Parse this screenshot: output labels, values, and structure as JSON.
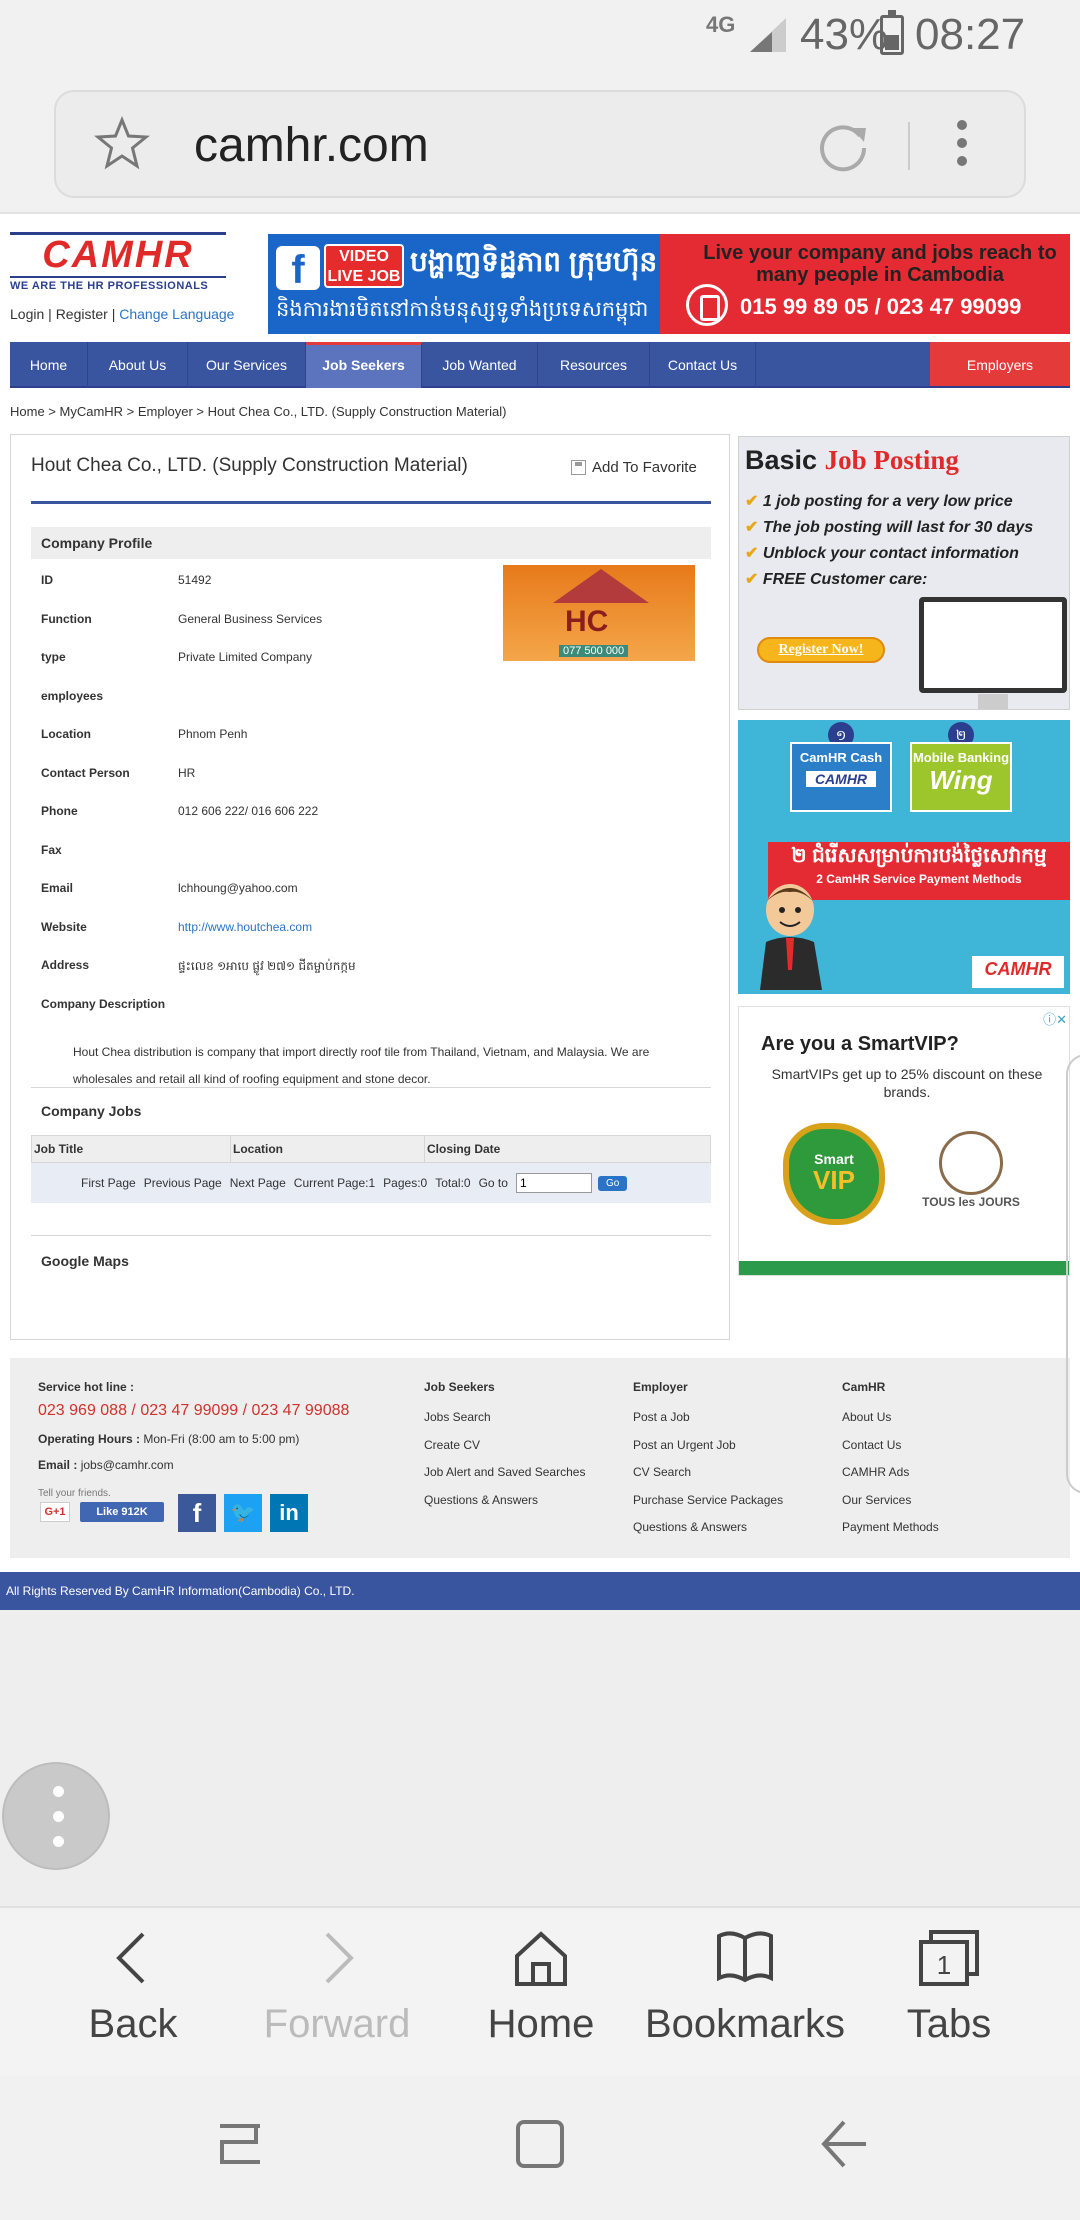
{
  "status_bar": {
    "network": "4G",
    "battery": "43%",
    "time": "08:27"
  },
  "address_bar": {
    "url": "camhr.com"
  },
  "site": {
    "logo": {
      "brand": "CAMHR",
      "tagline": "WE ARE THE HR PROFESSIONALS"
    },
    "login": "Login",
    "register": "Register",
    "change_language": "Change Language",
    "banner": {
      "fb_letter": "f",
      "video_label": "VIDEO",
      "live_label": "LIVE JOB",
      "kh_line1": "បង្ហាញទិដ្ឋភាព ក្រុមហ៊ុន",
      "kh_line2": "និងការងារមិតនៅកាន់មនុស្សទូទាំងប្រទេសកម្ពុជា",
      "reach": "Live your company and jobs reach to many people in Cambodia",
      "phones": "015 99 89 05 / 023 47 99099"
    },
    "nav": [
      "Home",
      "About Us",
      "Our Services",
      "Job Seekers",
      "Job Wanted",
      "Resources",
      "Contact Us"
    ],
    "nav_employers": "Employers",
    "breadcrumb": "Home > MyCamHR > Employer > Hout Chea Co., LTD. (Supply Construction Material)"
  },
  "company": {
    "title": "Hout Chea Co., LTD. (Supply Construction Material)",
    "add_favorite": "Add To Favorite",
    "profile_heading": "Company Profile",
    "logo_text": "HC",
    "logo_phone": "077 500 000",
    "fields": [
      {
        "label": "ID",
        "value": "51492"
      },
      {
        "label": "Function",
        "value": "General Business Services"
      },
      {
        "label": "type",
        "value": "Private Limited Company"
      },
      {
        "label": "employees",
        "value": ""
      },
      {
        "label": "Location",
        "value": "Phnom Penh"
      },
      {
        "label": "Contact Person",
        "value": "HR"
      },
      {
        "label": "Phone",
        "value": "012 606 222/ 016 606 222"
      },
      {
        "label": "Fax",
        "value": ""
      },
      {
        "label": "Email",
        "value": "lchhoung@yahoo.com"
      },
      {
        "label": "Website",
        "value": "http://www.houtchea.com"
      },
      {
        "label": "Address",
        "value": "ផ្ទះលេខ ១អាបេ ផ្លូវ ២៧១ ជីតម្ចាប់កក្កម"
      },
      {
        "label": "Company Description",
        "value": ""
      }
    ],
    "description": "Hout Chea distribution is company that import directly roof tile from Thailand, Vietnam, and Malaysia. We are wholesales and retail all kind of roofing equipment and stone decor.",
    "jobs_heading": "Company Jobs",
    "jobs_columns": [
      "Job Title",
      "Location",
      "Closing Date"
    ],
    "pager": {
      "first": "First Page",
      "previous": "Previous Page",
      "next": "Next Page",
      "current": "Current Page:1",
      "pages": "Pages:0",
      "total": "Total:0",
      "goto_label": "Go to",
      "goto_value": "1",
      "go": "Go"
    },
    "maps_heading": "Google Maps"
  },
  "ads": {
    "job_posting": {
      "title_basic": "Basic",
      "title_highlight": "Job Posting",
      "bullets": [
        "1 job posting for a very low price",
        "The job posting will last for 30 days",
        "Unblock your contact information",
        "FREE Customer care:"
      ],
      "button": "Register Now!"
    },
    "payment": {
      "num1": "១",
      "num2": "២",
      "cash_label": "CamHR Cash",
      "cash_logo": "CAMHR",
      "wing_label": "Mobile Banking",
      "wing_logo": "Wing",
      "kh_text": "២ ជំរើសសម្រាប់ការបង់ថ្លៃសេវាកម្ម",
      "en_text": "2 CamHR Service Payment Methods",
      "footer_logo": "CAMHR"
    },
    "smartvip": {
      "title": "Are you a SmartVIP?",
      "text": "SmartVIPs get up to 25% discount on these brands.",
      "vip_smart": "Smart",
      "vip_vip": "VIP",
      "brand2": "TOUS les JOURS"
    }
  },
  "footer": {
    "hotline_label": "Service hot line :",
    "hotline_numbers": "023 969 088 / 023 47 99099 / 023 47 99088",
    "hours_label": "Operating Hours :",
    "hours_value": "Mon-Fri (8:00 am to 5:00 pm)",
    "email_label": "Email :",
    "email_value": "jobs@camhr.com",
    "tell_friends": "Tell your friends.",
    "gplus": "G+1",
    "like": "Like 912K",
    "columns": [
      {
        "title": "Job Seekers",
        "links": [
          "Jobs Search",
          "Create CV",
          "Job Alert and Saved Searches",
          "Questions & Answers"
        ]
      },
      {
        "title": "Employer",
        "links": [
          "Post a Job",
          "Post an Urgent Job",
          "CV Search",
          "Purchase Service Packages",
          "Questions & Answers"
        ]
      },
      {
        "title": "CamHR",
        "links": [
          "About Us",
          "Contact Us",
          "CAMHR Ads",
          "Our Services",
          "Payment Methods"
        ]
      }
    ],
    "copyright": "All Rights Reserved By CamHR Information(Cambodia) Co., LTD."
  },
  "browser_nav": {
    "back": "Back",
    "forward": "Forward",
    "home": "Home",
    "bookmarks": "Bookmarks",
    "tabs": "Tabs",
    "tab_count": "1"
  }
}
